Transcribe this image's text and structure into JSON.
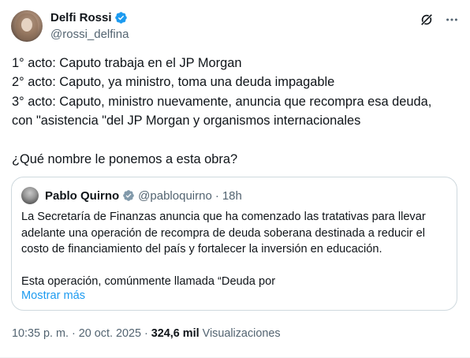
{
  "author": {
    "display_name": "Delfi Rossi",
    "handle": "@rossi_delfina",
    "verified": true
  },
  "colors": {
    "verified_badge": "#1d9bf0",
    "secondary_text": "#536471",
    "link": "#1d9bf0",
    "border": "#cfd9de"
  },
  "header_actions": [
    "grok-icon",
    "more-icon"
  ],
  "tweet": {
    "lines": [
      "1° acto: Caputo trabaja en el JP Morgan",
      "2° acto: Caputo, ya ministro, toma una deuda impagable",
      "3° acto: Caputo, ministro nuevamente, anuncia que recompra esa deuda,",
      "con \"asistencia \"del JP Morgan y organismos internacionales",
      "¿Qué nombre le ponemos a esta obra?"
    ]
  },
  "quote": {
    "display_name": "Pablo Quirno",
    "verified_type": "government",
    "handle": "@pabloquirno",
    "separator": "·",
    "time": "18h",
    "lines": [
      "La Secretaría de Finanzas anuncia que ha comenzado las tratativas para  llevar",
      "adelante una operación de recompra de deuda soberana destinada a reducir el",
      "costo de financiamiento del país y fortalecer la inversión en educación.",
      "Esta operación, comúnmente llamada “Deuda por"
    ],
    "show_more": "Mostrar más"
  },
  "meta": {
    "timestamp": "10:35 p. m. · 20 oct. 2025",
    "separator": " · ",
    "views_count": "324,6 mil",
    "views_label": "Visualizaciones"
  }
}
